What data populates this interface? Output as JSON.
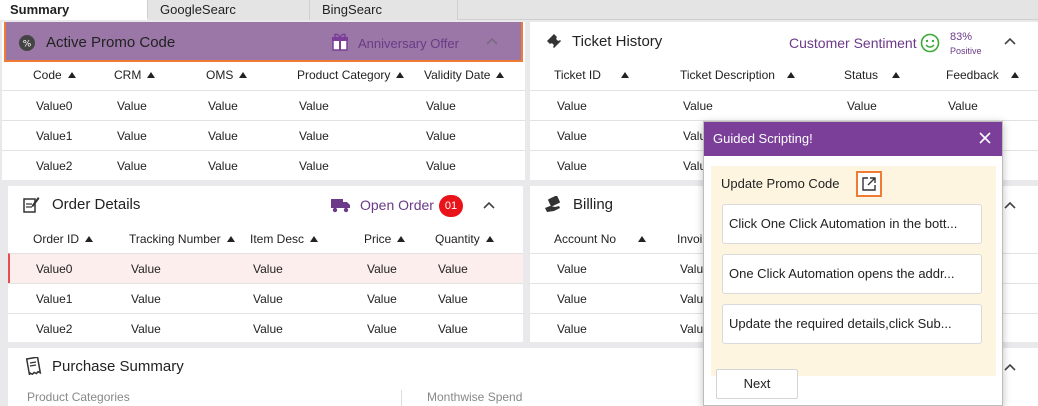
{
  "tabs": [
    {
      "label": "Summary",
      "active": true
    },
    {
      "label": "GoogleSearc",
      "active": false
    },
    {
      "label": "BingSearc",
      "active": false
    }
  ],
  "promo": {
    "title": "Active Promo Code",
    "offer_label": "Anniversary Offer",
    "columns": [
      "Code",
      "CRM",
      "OMS",
      "Product Category",
      "Validity Date"
    ],
    "rows": [
      [
        "Value0",
        "Value",
        "Value",
        "Value",
        "Value"
      ],
      [
        "Value1",
        "Value",
        "Value",
        "Value",
        "Value"
      ],
      [
        "Value2",
        "Value",
        "Value",
        "Value",
        "Value"
      ]
    ]
  },
  "ticket": {
    "title": "Ticket History",
    "sentiment_label": "Customer Sentiment",
    "sentiment_percent": "83%",
    "sentiment_text": "Positive",
    "columns": [
      "Ticket ID",
      "Ticket Description",
      "Status",
      "Feedback"
    ],
    "rows": [
      [
        "Value",
        "Value",
        "Value",
        "Value"
      ],
      [
        "Value",
        "Valu",
        "",
        ""
      ],
      [
        "Value",
        "Valu",
        "",
        ""
      ]
    ]
  },
  "orders": {
    "title": "Order Details",
    "open_order_label": "Open Order",
    "open_order_count": "01",
    "columns": [
      "Order ID",
      "Tracking Number",
      "Item Desc",
      "Price",
      "Quantity"
    ],
    "rows": [
      [
        "Value0",
        "Value",
        "Value",
        "Value",
        "Value"
      ],
      [
        "Value1",
        "Value",
        "Value",
        "Value",
        "Value"
      ],
      [
        "Value2",
        "Value",
        "Value",
        "Value",
        "Value"
      ]
    ]
  },
  "billing": {
    "title": "Billing",
    "columns": [
      "Account No",
      "Invoi"
    ],
    "rows": [
      [
        "Value",
        "Valu"
      ],
      [
        "Value",
        "Valu"
      ],
      [
        "Value",
        "Valu"
      ]
    ]
  },
  "purchase": {
    "title": "Purchase Summary",
    "left_label": "Product Categories",
    "right_label": "Monthwise Spend"
  },
  "guided": {
    "title": "Guided Scripting!",
    "step_title": "Update Promo Code",
    "steps": [
      "Click One Click Automation in the bott...",
      "One Click Automation opens the addr...",
      "Update the required details,click Sub..."
    ],
    "next_label": "Next"
  },
  "colors": {
    "accent_purple": "#7b3f99",
    "promo_header": "#9a77a6",
    "highlight_orange": "#f07b35",
    "sentiment_green": "#3aaa35",
    "badge_red": "#e8141a"
  }
}
